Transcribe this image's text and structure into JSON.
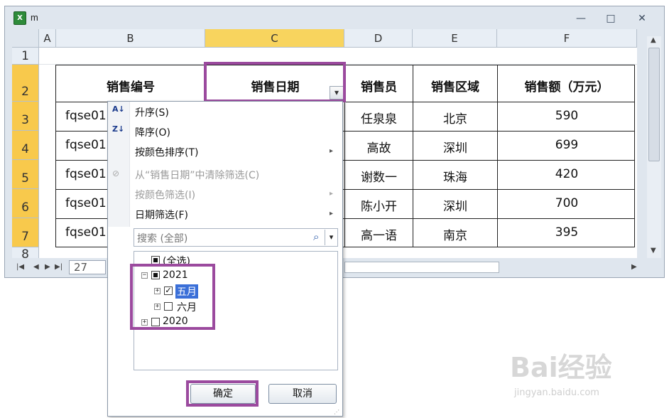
{
  "window": {
    "title": "m",
    "app_icon": "excel-icon",
    "icon_glyph": "X"
  },
  "controls": {
    "minimize": "—",
    "restore": "□",
    "close": "✕"
  },
  "columns": [
    "A",
    "B",
    "C",
    "D",
    "E",
    "F"
  ],
  "rows": [
    "1",
    "2",
    "3",
    "4",
    "5",
    "6",
    "7",
    "8"
  ],
  "table": {
    "headers": [
      "销售编号",
      "销售日期",
      "销售员",
      "销售区域",
      "销售额（万元）"
    ],
    "rows": [
      [
        "fqse01",
        "",
        "任泉泉",
        "北京",
        "590"
      ],
      [
        "fqse01",
        "",
        "高故",
        "深圳",
        "699"
      ],
      [
        "fqse01",
        "",
        "谢数一",
        "珠海",
        "420"
      ],
      [
        "fqse01",
        "",
        "陈小开",
        "深圳",
        "700"
      ],
      [
        "fqse01",
        "",
        "高一语",
        "南京",
        "395"
      ]
    ]
  },
  "sheet_tab": "27",
  "filter_menu": {
    "items": [
      {
        "label": "升序(S)",
        "icon": "sort-ascending-icon",
        "glyph": "A↓",
        "disabled": false
      },
      {
        "label": "降序(O)",
        "icon": "sort-descending-icon",
        "glyph": "Z↓",
        "disabled": false
      },
      {
        "label": "按颜色排序(T)",
        "disabled": false,
        "submenu": true
      },
      {
        "label": "从“销售日期”中清除筛选(C)",
        "icon": "clear-filter-icon",
        "glyph": "⊘",
        "disabled": true
      },
      {
        "label": "按颜色筛选(I)",
        "disabled": true,
        "submenu": true
      },
      {
        "label": "日期筛选(F)",
        "disabled": false,
        "submenu": true
      }
    ],
    "search_placeholder": "搜索 (全部)",
    "tree": {
      "select_all": "(全选)",
      "year_2021": "2021",
      "may": "五月",
      "june": "六月",
      "year_2020": "2020"
    },
    "ok": "确定",
    "cancel": "取消"
  },
  "glyphs": {
    "dropdown": "▾",
    "search": "⌕",
    "submenu_arrow": "▸",
    "check": "✓",
    "expand": "+",
    "collapse": "−"
  },
  "scroll_arrows": {
    "up": "▲",
    "down": "▼",
    "left": "◀",
    "right": "▶",
    "first": "|◀",
    "last": "▶|"
  },
  "watermark": {
    "brand": "Bai经验",
    "url": "jingyan.baidu.com"
  },
  "colors": {
    "highlight": "#9b4a9e",
    "selected_header": "#f8d45e",
    "row_header_selected": "#f8c94c"
  }
}
